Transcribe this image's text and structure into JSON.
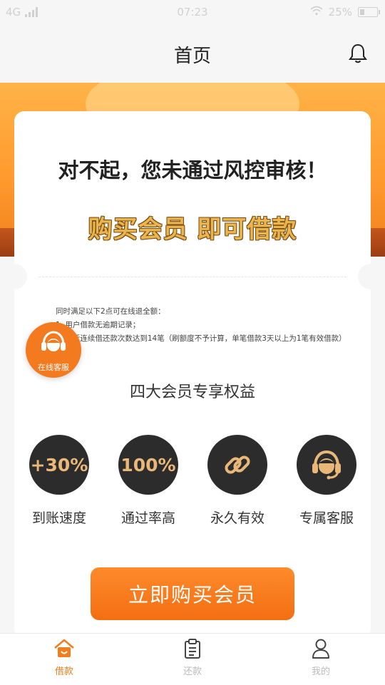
{
  "status_bar": {
    "network": "4G",
    "time": "07:23",
    "battery": "25%"
  },
  "header": {
    "title": "首页",
    "bell_icon": "bell-icon"
  },
  "card": {
    "title": "对不起，您未通过风控审核！",
    "subtitle": "购买会员 即可借款",
    "rules": [
      "同时满足以下2点可在线退全额：",
      "1. 用户借款无逾期记录；",
      "2. 最近连续借还款次数达到14笔（刷额度不予计算，单笔借款3天以上为1笔有效借款）"
    ],
    "benefits_title": "四大会员专享权益",
    "benefits": [
      {
        "icon_text": "+30%",
        "label": "到账速度"
      },
      {
        "icon_text": "100%",
        "label": "通过率高"
      },
      {
        "icon": "link-icon",
        "label": "永久有效"
      },
      {
        "icon": "customer-service-icon",
        "label": "专属客服"
      }
    ],
    "buy_button": "立即购买会员"
  },
  "floating_service": {
    "label": "在线客服",
    "icon": "customer-service-icon"
  },
  "bottom_nav": [
    {
      "label": "借款",
      "icon": "home-icon",
      "active": true
    },
    {
      "label": "还款",
      "icon": "clipboard-icon",
      "active": false
    },
    {
      "label": "我的",
      "icon": "user-icon",
      "active": false
    }
  ],
  "colors": {
    "accent": "#f07d1e",
    "gold": "#e9b878",
    "dark_circle": "#2c2c2c"
  }
}
